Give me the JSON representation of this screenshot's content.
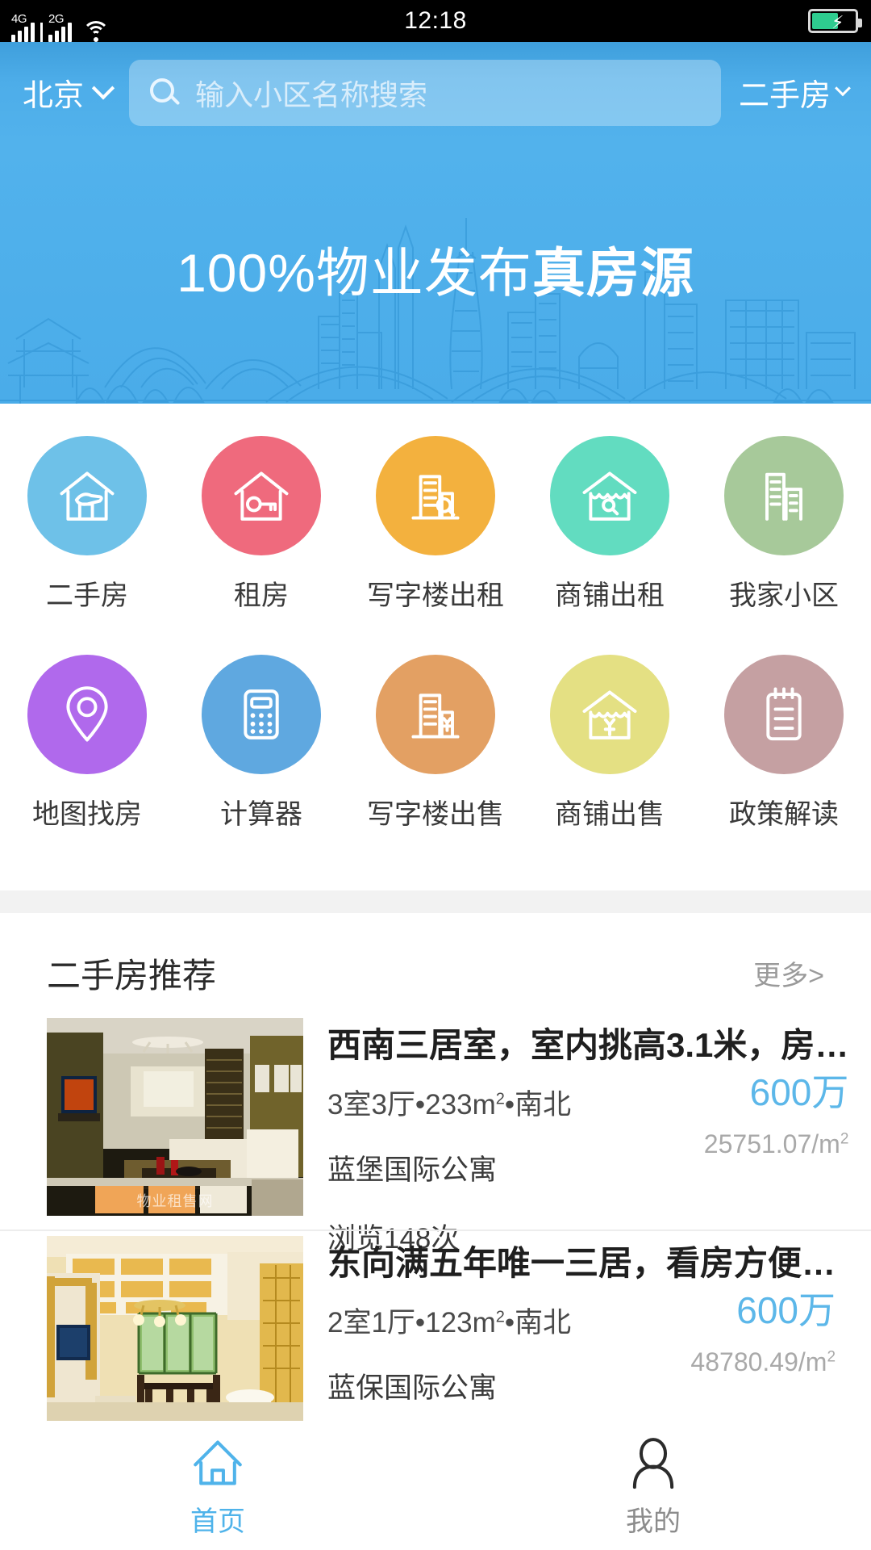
{
  "statusbar": {
    "net_primary": "4G",
    "net_secondary": "2G",
    "wifi_icon": "wifi-icon",
    "time": "12:18",
    "battery_icon": "battery-charging-icon"
  },
  "header": {
    "city": "北京",
    "city_chevron_icon": "chevron-down-icon",
    "search": {
      "icon": "search-icon",
      "placeholder": "输入小区名称搜索",
      "value": ""
    },
    "category": "二手房",
    "category_chevron_icon": "chevron-down-icon"
  },
  "banner": {
    "title_prefix": "100%物业发布",
    "title_emphasis": "真房源",
    "illustration": "city-skyline-outline"
  },
  "grid": {
    "rows": [
      [
        {
          "label": "二手房",
          "icon": "house-hand-icon",
          "color": "#6ec1e8"
        },
        {
          "label": "租房",
          "icon": "house-key-icon",
          "color": "#ef6a7d"
        },
        {
          "label": "写字楼出租",
          "icon": "office-search-icon",
          "color": "#f3b13e"
        },
        {
          "label": "商铺出租",
          "icon": "shop-search-icon",
          "color": "#62dcc0"
        },
        {
          "label": "我家小区",
          "icon": "buildings-icon",
          "color": "#a7c99a"
        }
      ],
      [
        {
          "label": "地图找房",
          "icon": "map-pin-icon",
          "color": "#b069ec"
        },
        {
          "label": "计算器",
          "icon": "calculator-icon",
          "color": "#5fa8e0"
        },
        {
          "label": "写字楼出售",
          "icon": "office-yuan-icon",
          "color": "#e3a063"
        },
        {
          "label": "商铺出售",
          "icon": "shop-yuan-icon",
          "color": "#e4e083"
        },
        {
          "label": "政策解读",
          "icon": "clipboard-icon",
          "color": "#c5a0a2"
        }
      ]
    ]
  },
  "recommend": {
    "title": "二手房推荐",
    "more_label": "更多>",
    "items": [
      {
        "title": "西南三居室，室内挑高3.1米，房…",
        "spec": "3室3厅•233m²•南北",
        "community": "蓝堡国际公寓",
        "views": "浏览148次",
        "price_total": "600万",
        "price_unit": "25751.07/m²",
        "photo": "living-room-photo",
        "watermark": "物业租售网"
      },
      {
        "title": "东向满五年唯一三居，看房方便…",
        "spec": "2室1厅•123m²•南北",
        "community": "蓝保国际公寓",
        "views": "",
        "price_total": "600万",
        "price_unit": "48780.49/m²",
        "photo": "dining-room-photo",
        "watermark": ""
      }
    ]
  },
  "tabbar": {
    "tabs": [
      {
        "label": "首页",
        "icon": "home-icon",
        "active": true,
        "color": "#4fb3ea"
      },
      {
        "label": "我的",
        "icon": "person-icon",
        "active": false,
        "color": "#2b2b2b"
      }
    ]
  },
  "colors": {
    "brand_blue": "#4dade9",
    "price_blue": "#5cb7e9",
    "divider_gray": "#f2f2f2"
  }
}
